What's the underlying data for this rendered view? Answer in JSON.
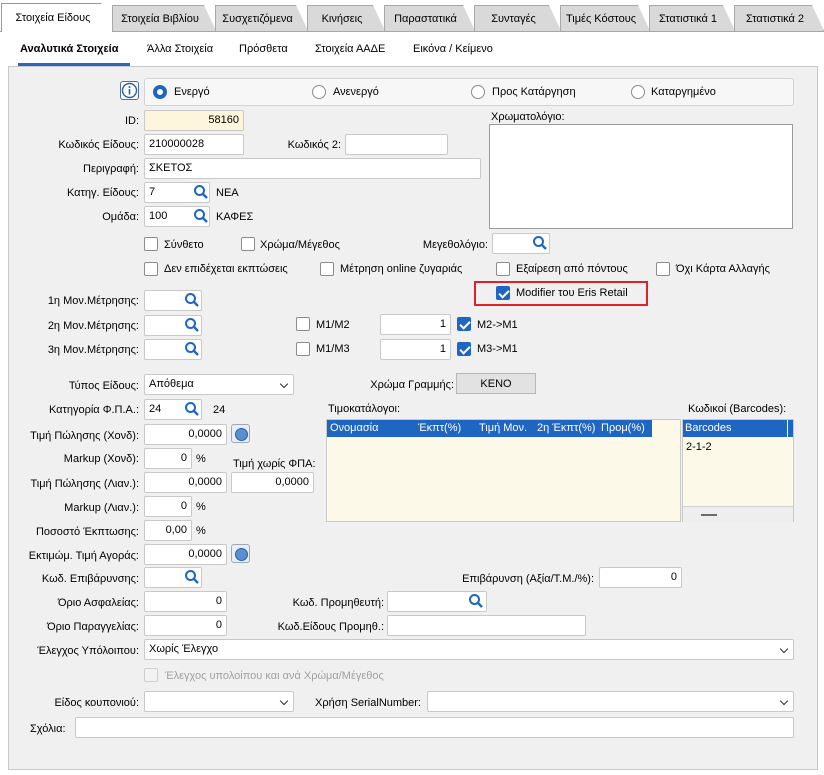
{
  "top_tabs": [
    "Στοιχεία Είδους",
    "Στοιχεία Βιβλίου",
    "Συσχετιζόμενα",
    "Κινήσεις",
    "Παραστατικά",
    "Συνταγές",
    "Τιμές Κόστους",
    "Στατιστικά 1",
    "Στατιστικά 2"
  ],
  "sub_tabs": [
    "Αναλυτικά Στοιχεία",
    "Άλλα Στοιχεία",
    "Πρόσθετα",
    "Στοιχεία ΑΑΔΕ",
    "Εικόνα / Κείμενο"
  ],
  "status": {
    "options": [
      "Ενεργό",
      "Ανενεργό",
      "Προς Κατάργηση",
      "Καταργημένο"
    ],
    "selected": "Ενεργό"
  },
  "fields": {
    "id_label": "ID:",
    "id_value": "58160",
    "code_label": "Κωδικός Είδους:",
    "code_value": "210000028",
    "code2_label": "Κωδικός 2:",
    "code2_value": "",
    "desc_label": "Περιγραφή:",
    "desc_value": "ΣΚΕΤΟΣ",
    "category_label": "Κατηγ. Είδους:",
    "category_value": "7",
    "category_name": "ΝΕΑ",
    "group_label": "Ομάδα:",
    "group_value": "100",
    "group_name": "ΚΑΦΕΣ",
    "palette_label": "Χρωματολόγιο:",
    "sizechart_label": "Μεγεθολόγιο:"
  },
  "checkboxes": {
    "synthetic": "Σύνθετο",
    "color_size": "Χρώμα/Μέγεθος",
    "no_discount": "Δεν επιδέχεται εκπτώσεις",
    "online_scale": "Μέτρηση online ζυγαριάς",
    "exclude_points": "Εξαίρεση από πόντους",
    "no_change_card": "Όχι Κάρτα Αλλαγής",
    "modifier_eris": "Modifier του Eris Retail",
    "modifier_eris_checked": true
  },
  "units": {
    "u1_label": "1η Μον.Μέτρησης:",
    "u2_label": "2η Μον.Μέτρησης:",
    "u3_label": "3η Μον.Μέτρησης:",
    "m1m2_label": "Μ1/Μ2",
    "m1m2_value": "1",
    "m2m1_label": "Μ2->Μ1",
    "m1m3_label": "Μ1/Μ3",
    "m1m3_value": "1",
    "m3m1_label": "Μ3->Μ1"
  },
  "pricing": {
    "type_label": "Τύπος Είδους:",
    "type_value": "Απόθεμα",
    "line_color_label": "Χρώμα Γραμμής:",
    "line_color_value": "ΚΕΝΟ",
    "vat_label": "Κατηγορία Φ.Π.Α.:",
    "vat_value": "24",
    "vat_rate": "24",
    "wholesale_label": "Τιμή Πώλησης (Χονδ):",
    "wholesale_value": "0,0000",
    "markup_w_label": "Markup (Χονδ):",
    "markup_w_value": "0",
    "no_vat_label": "Τιμή χωρίς ΦΠΑ:",
    "no_vat_value": "0,0000",
    "retail_label": "Τιμή Πώλησης (Λιαν.):",
    "retail_value": "0,0000",
    "markup_r_label": "Markup (Λιαν.):",
    "markup_r_value": "0",
    "discount_label": "Ποσοστό Έκπτωσης:",
    "discount_value": "0,00",
    "est_buy_label": "Εκτιμώμ. Τιμή Αγοράς:",
    "est_buy_value": "0,0000",
    "percent": "%"
  },
  "pricelists": {
    "title": "Τιμοκατάλογοι:",
    "columns": [
      "Ονομασία",
      "Έκπτ(%)",
      "Τιμή Μον.",
      "2η Έκπτ(%)",
      "Προμ(%)"
    ]
  },
  "barcodes": {
    "title": "Κωδικοί (Barcodes):",
    "column": "Barcodes",
    "rows": [
      "2-1-2"
    ]
  },
  "other": {
    "surcharge_code_label": "Κωδ. Επιβάρυνσης:",
    "surcharge_label": "Επιβάρυνση (Αξία/Τ.Μ./%):",
    "surcharge_value": "0",
    "safety_label": "Όριο Ασφαλείας:",
    "safety_value": "0",
    "supplier_label": "Κωδ. Προμηθευτή:",
    "order_label": "Όριο Παραγγελίας:",
    "order_value": "0",
    "supplier_item_label": "Κωδ.Είδους Προμηθ.:",
    "balance_label": "Έλεγχος Υπόλοιπου:",
    "balance_value": "Χωρίς Έλεγχο",
    "balance_by_color": "Έλεγχος υπολοίπου και ανά Χρώμα/Μέγεθος",
    "coupon_label": "Είδος κουπονιού:",
    "serial_label": "Χρήση SerialNumber:",
    "comments_label": "Σχόλια:"
  },
  "colors": {
    "accent": "#1f66c2",
    "highlight_box": "#e0202a",
    "id_field": "#fdf5dc"
  }
}
